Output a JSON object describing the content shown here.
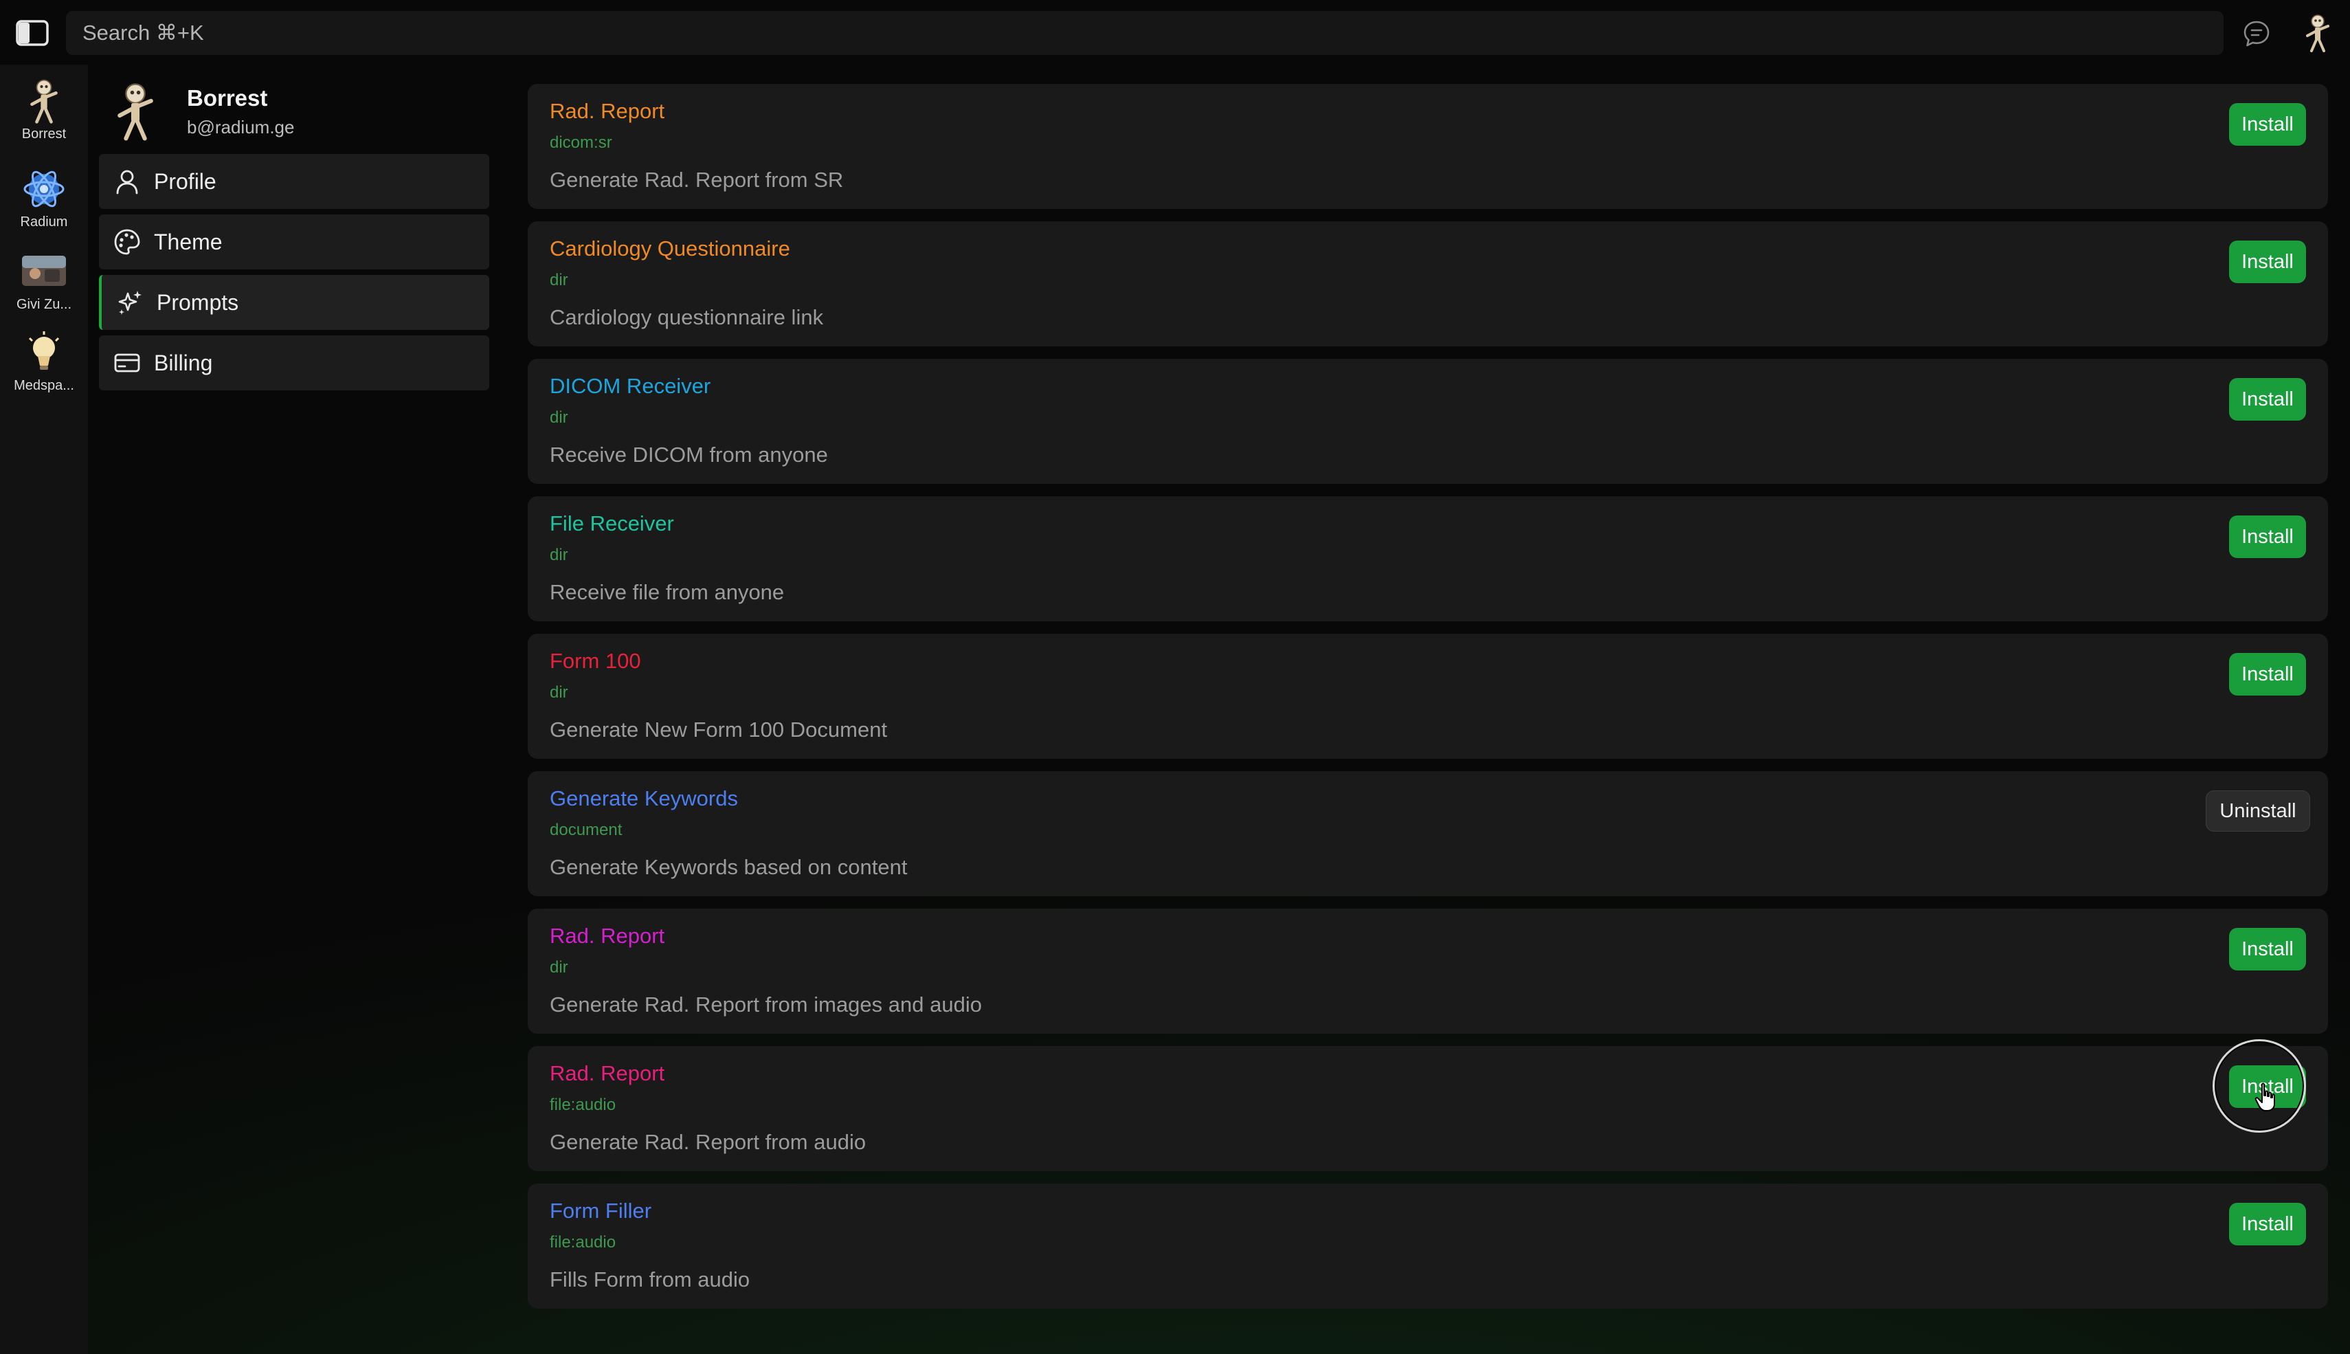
{
  "topbar": {
    "search_placeholder": "Search ⌘+K",
    "icons": [
      "sidebar-toggle-icon",
      "chat-bubble-icon",
      "skeleton-avatar-icon"
    ]
  },
  "workspaces": [
    {
      "label": "Borrest",
      "icon": "skeleton-avatar-icon"
    },
    {
      "label": "Radium",
      "icon": "blue-atom-icon"
    },
    {
      "label": "Givi Zu...",
      "icon": "photo-thumbnail-icon"
    },
    {
      "label": "Medspa...",
      "icon": "lightbulb-icon"
    }
  ],
  "profile": {
    "name": "Borrest",
    "email": "b@radium.ge"
  },
  "menu": [
    {
      "label": "Profile",
      "icon": "user-icon"
    },
    {
      "label": "Theme",
      "icon": "palette-icon"
    },
    {
      "label": "Prompts",
      "icon": "sparkles-icon",
      "active": true
    },
    {
      "label": "Billing",
      "icon": "credit-card-icon"
    }
  ],
  "prompts": [
    {
      "title": "Rad. Report",
      "type": "dicom:sr",
      "description": "Generate Rad. Report from SR",
      "action": "Install",
      "color": "#f08a24"
    },
    {
      "title": "Cardiology Questionnaire",
      "type": "dir",
      "description": "Cardiology questionnaire link",
      "action": "Install",
      "color": "#f08a24"
    },
    {
      "title": "DICOM Receiver",
      "type": "dir",
      "description": "Receive DICOM from anyone",
      "action": "Install",
      "color": "#1ba6e0"
    },
    {
      "title": "File Receiver",
      "type": "dir",
      "description": "Receive file from anyone",
      "action": "Install",
      "color": "#1cc4a0"
    },
    {
      "title": "Form 100",
      "type": "dir",
      "description": "Generate New Form 100 Document",
      "action": "Install",
      "color": "#e8223a"
    },
    {
      "title": "Generate Keywords",
      "type": "document",
      "description": "Generate Keywords based on content",
      "action": "Uninstall",
      "color": "#4d7ff0"
    },
    {
      "title": "Rad. Report",
      "type": "dir",
      "description": "Generate Rad. Report from images and audio",
      "action": "Install",
      "color": "#d81fd0"
    },
    {
      "title": "Rad. Report",
      "type": "file:audio",
      "description": "Generate Rad. Report from audio",
      "action": "Install",
      "color": "#ea1f7c"
    },
    {
      "title": "Form Filler",
      "type": "file:audio",
      "description": "Fills Form from audio",
      "action": "Install",
      "color": "#4d7ff0"
    }
  ],
  "colors": {
    "accent": "#1a9e3c",
    "type_label": "#3d9a4e",
    "card_bg": "#1a1a1a"
  }
}
